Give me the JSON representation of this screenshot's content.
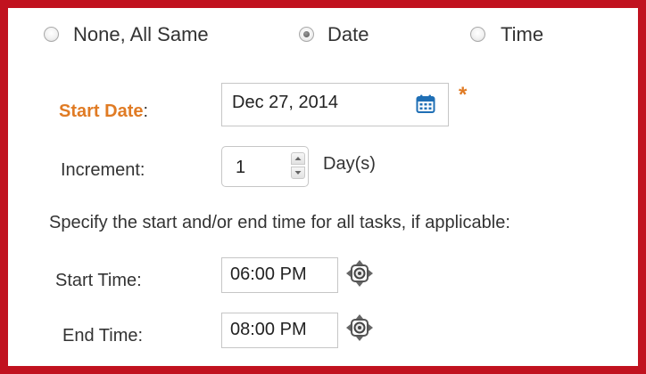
{
  "mode": {
    "options": [
      {
        "label": "None, All Same",
        "checked": false
      },
      {
        "label": "Date",
        "checked": true
      },
      {
        "label": "Time",
        "checked": false
      }
    ]
  },
  "start_date": {
    "label": "Start Date",
    "colon": ":",
    "value": "Dec 27, 2014",
    "required_mark": "*",
    "icon": "calendar-icon"
  },
  "increment": {
    "label": "Increment:",
    "value": "1",
    "unit": "Day(s)"
  },
  "instructions": "Specify the start and/or end time for all tasks, if applicable:",
  "start_time": {
    "label": "Start Time:",
    "value": "06:00 PM",
    "icon": "move-arrows-icon"
  },
  "end_time": {
    "label": "End Time:",
    "value": "08:00 PM",
    "icon": "move-arrows-icon"
  },
  "colors": {
    "frame": "#c1121f",
    "accent": "#e07b24",
    "calendar": "#1f6fb5"
  }
}
